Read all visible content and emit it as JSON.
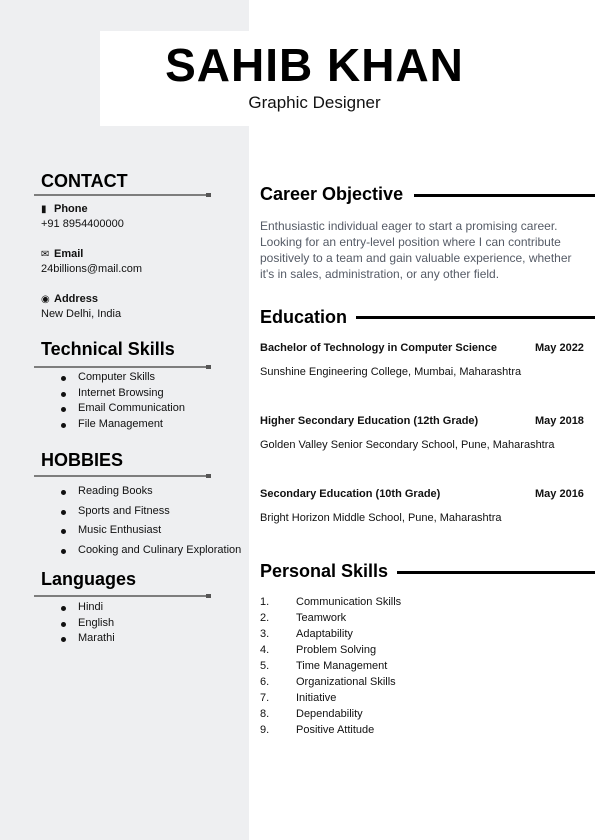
{
  "header": {
    "name": "SAHIB KHAN",
    "role": "Graphic Designer"
  },
  "contact": {
    "title": "CONTACT",
    "phone_label": "Phone",
    "phone": "+91 8954400000",
    "email_label": "Email",
    "email": "24billions@mail.com",
    "address_label": "Address",
    "address": "New Delhi, India"
  },
  "technical_skills": {
    "title": "Technical Skills",
    "items": [
      "Computer Skills",
      "Internet Browsing",
      "Email Communication",
      "File Management"
    ]
  },
  "hobbies": {
    "title": "HOBBIES",
    "items": [
      "Reading Books",
      "Sports and Fitness",
      "Music Enthusiast",
      "Cooking and Culinary Exploration"
    ]
  },
  "languages": {
    "title": "Languages",
    "items": [
      "Hindi",
      "English",
      "Marathi"
    ]
  },
  "career": {
    "title": "Career Objective",
    "text": "Enthusiastic individual eager to start a promising career. Looking for an entry-level position where I can contribute positively to a team and gain valuable experience, whether it's in sales, administration, or any other field."
  },
  "education": {
    "title": "Education",
    "entries": [
      {
        "degree": "Bachelor of Technology in Computer Science",
        "date": "May 2022",
        "school": "Sunshine Engineering College, Mumbai, Maharashtra"
      },
      {
        "degree": "Higher Secondary Education (12th Grade)",
        "date": "May 2018",
        "school": "Golden Valley Senior Secondary School, Pune, Maharashtra"
      },
      {
        "degree": "Secondary Education (10th Grade)",
        "date": "May 2016",
        "school": "Bright Horizon Middle School, Pune, Maharashtra"
      }
    ]
  },
  "personal_skills": {
    "title": "Personal Skills",
    "items": [
      {
        "num": "1.",
        "label": "Communication Skills"
      },
      {
        "num": "2.",
        "label": "Teamwork"
      },
      {
        "num": "3.",
        "label": "Adaptability"
      },
      {
        "num": "4.",
        "label": "Problem Solving"
      },
      {
        "num": "5.",
        "label": "Time Management"
      },
      {
        "num": "6.",
        "label": "Organizational Skills"
      },
      {
        "num": "7.",
        "label": "Initiative"
      },
      {
        "num": "8.",
        "label": "Dependability"
      },
      {
        "num": "9.",
        "label": "Positive Attitude"
      }
    ]
  }
}
